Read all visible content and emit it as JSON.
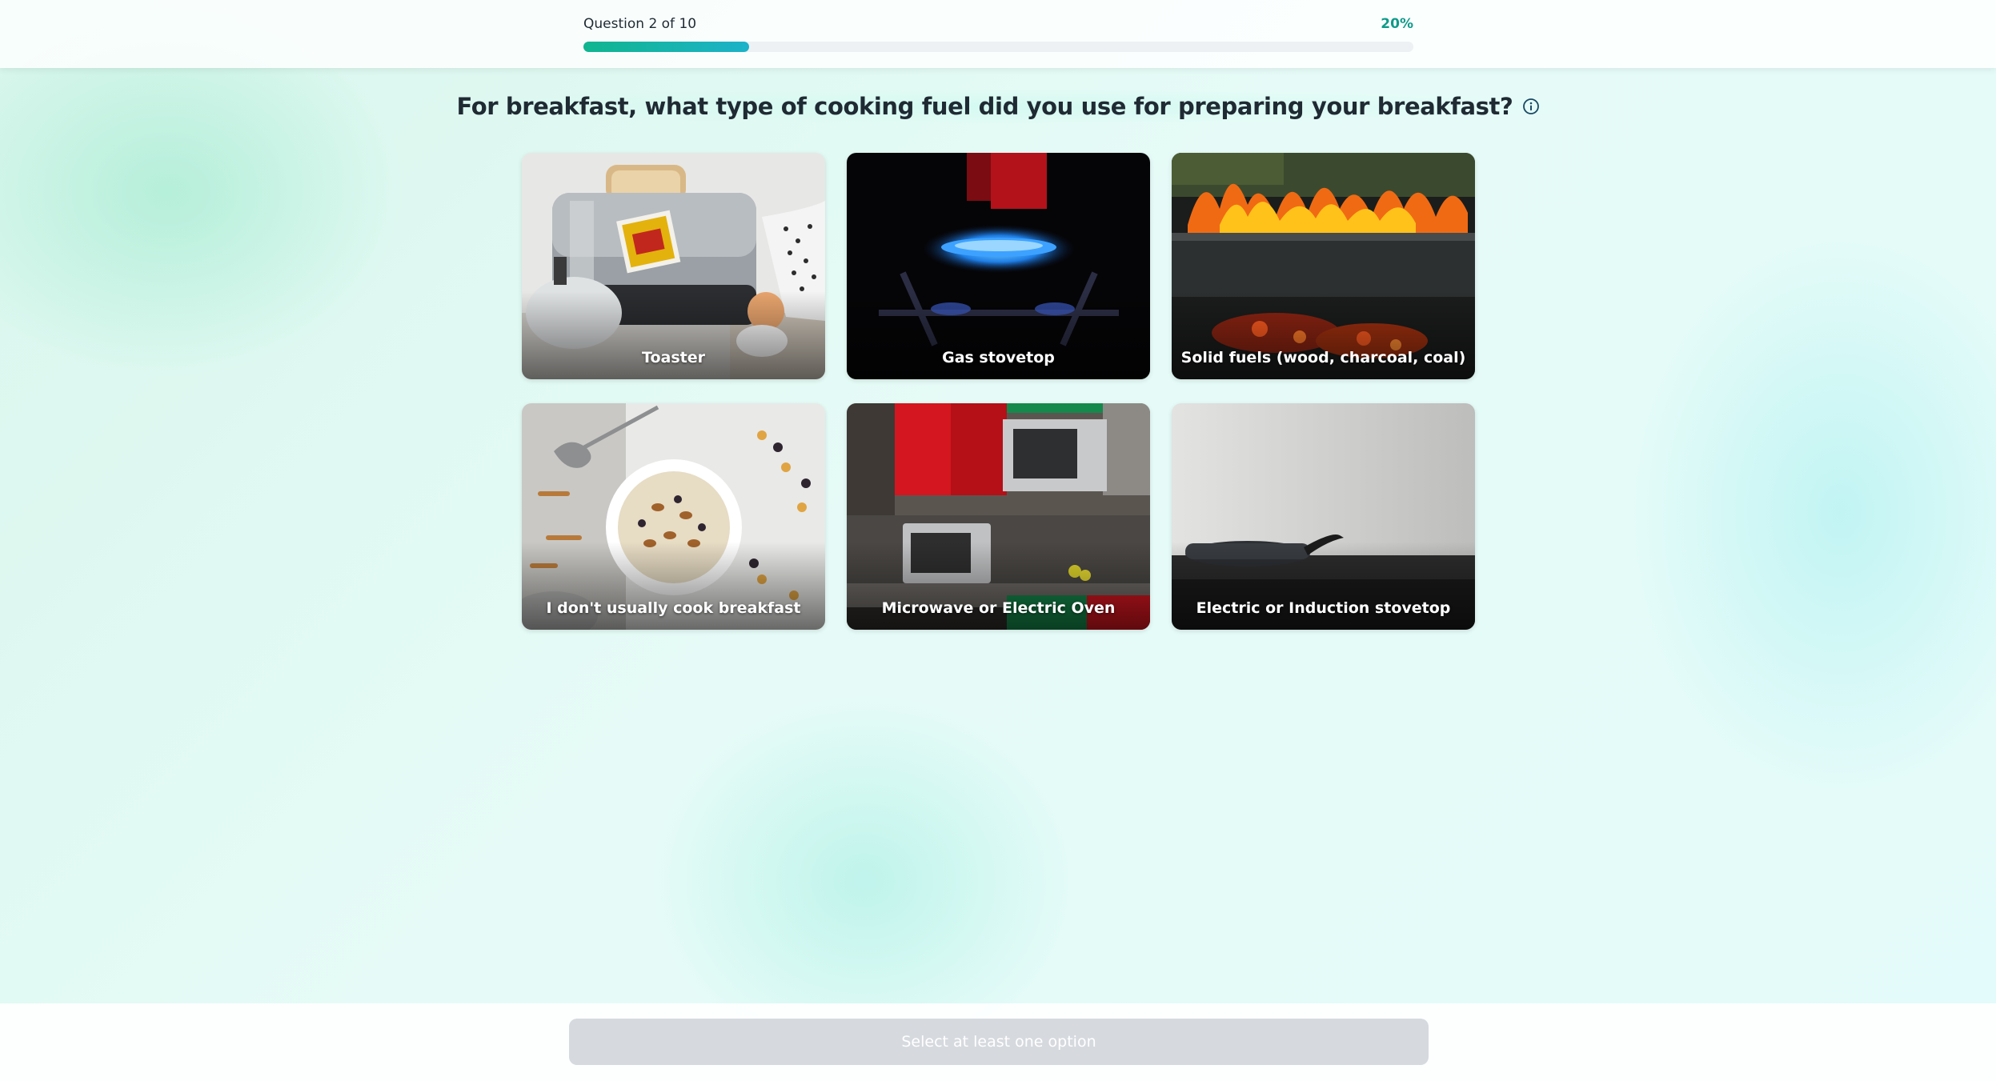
{
  "progress": {
    "label": "Question 2 of 10",
    "percent_label": "20%",
    "fraction": 0.2
  },
  "question": {
    "text": "For breakfast, what type of cooking fuel did you use for preparing your breakfast?",
    "info_icon": "info-icon"
  },
  "options": [
    {
      "label": "Toaster"
    },
    {
      "label": "Gas stovetop"
    },
    {
      "label": "Solid fuels (wood, charcoal, coal)"
    },
    {
      "label": "I don't usually cook breakfast"
    },
    {
      "label": "Microwave or Electric Oven"
    },
    {
      "label": "Electric or Induction stovetop"
    }
  ],
  "footer": {
    "button_label": "Select at least one option"
  },
  "colors": {
    "accent": "#0e9a8a",
    "progress_start": "#10b58f",
    "progress_end": "#1cb2c9",
    "disabled_button": "#d6d9de"
  }
}
